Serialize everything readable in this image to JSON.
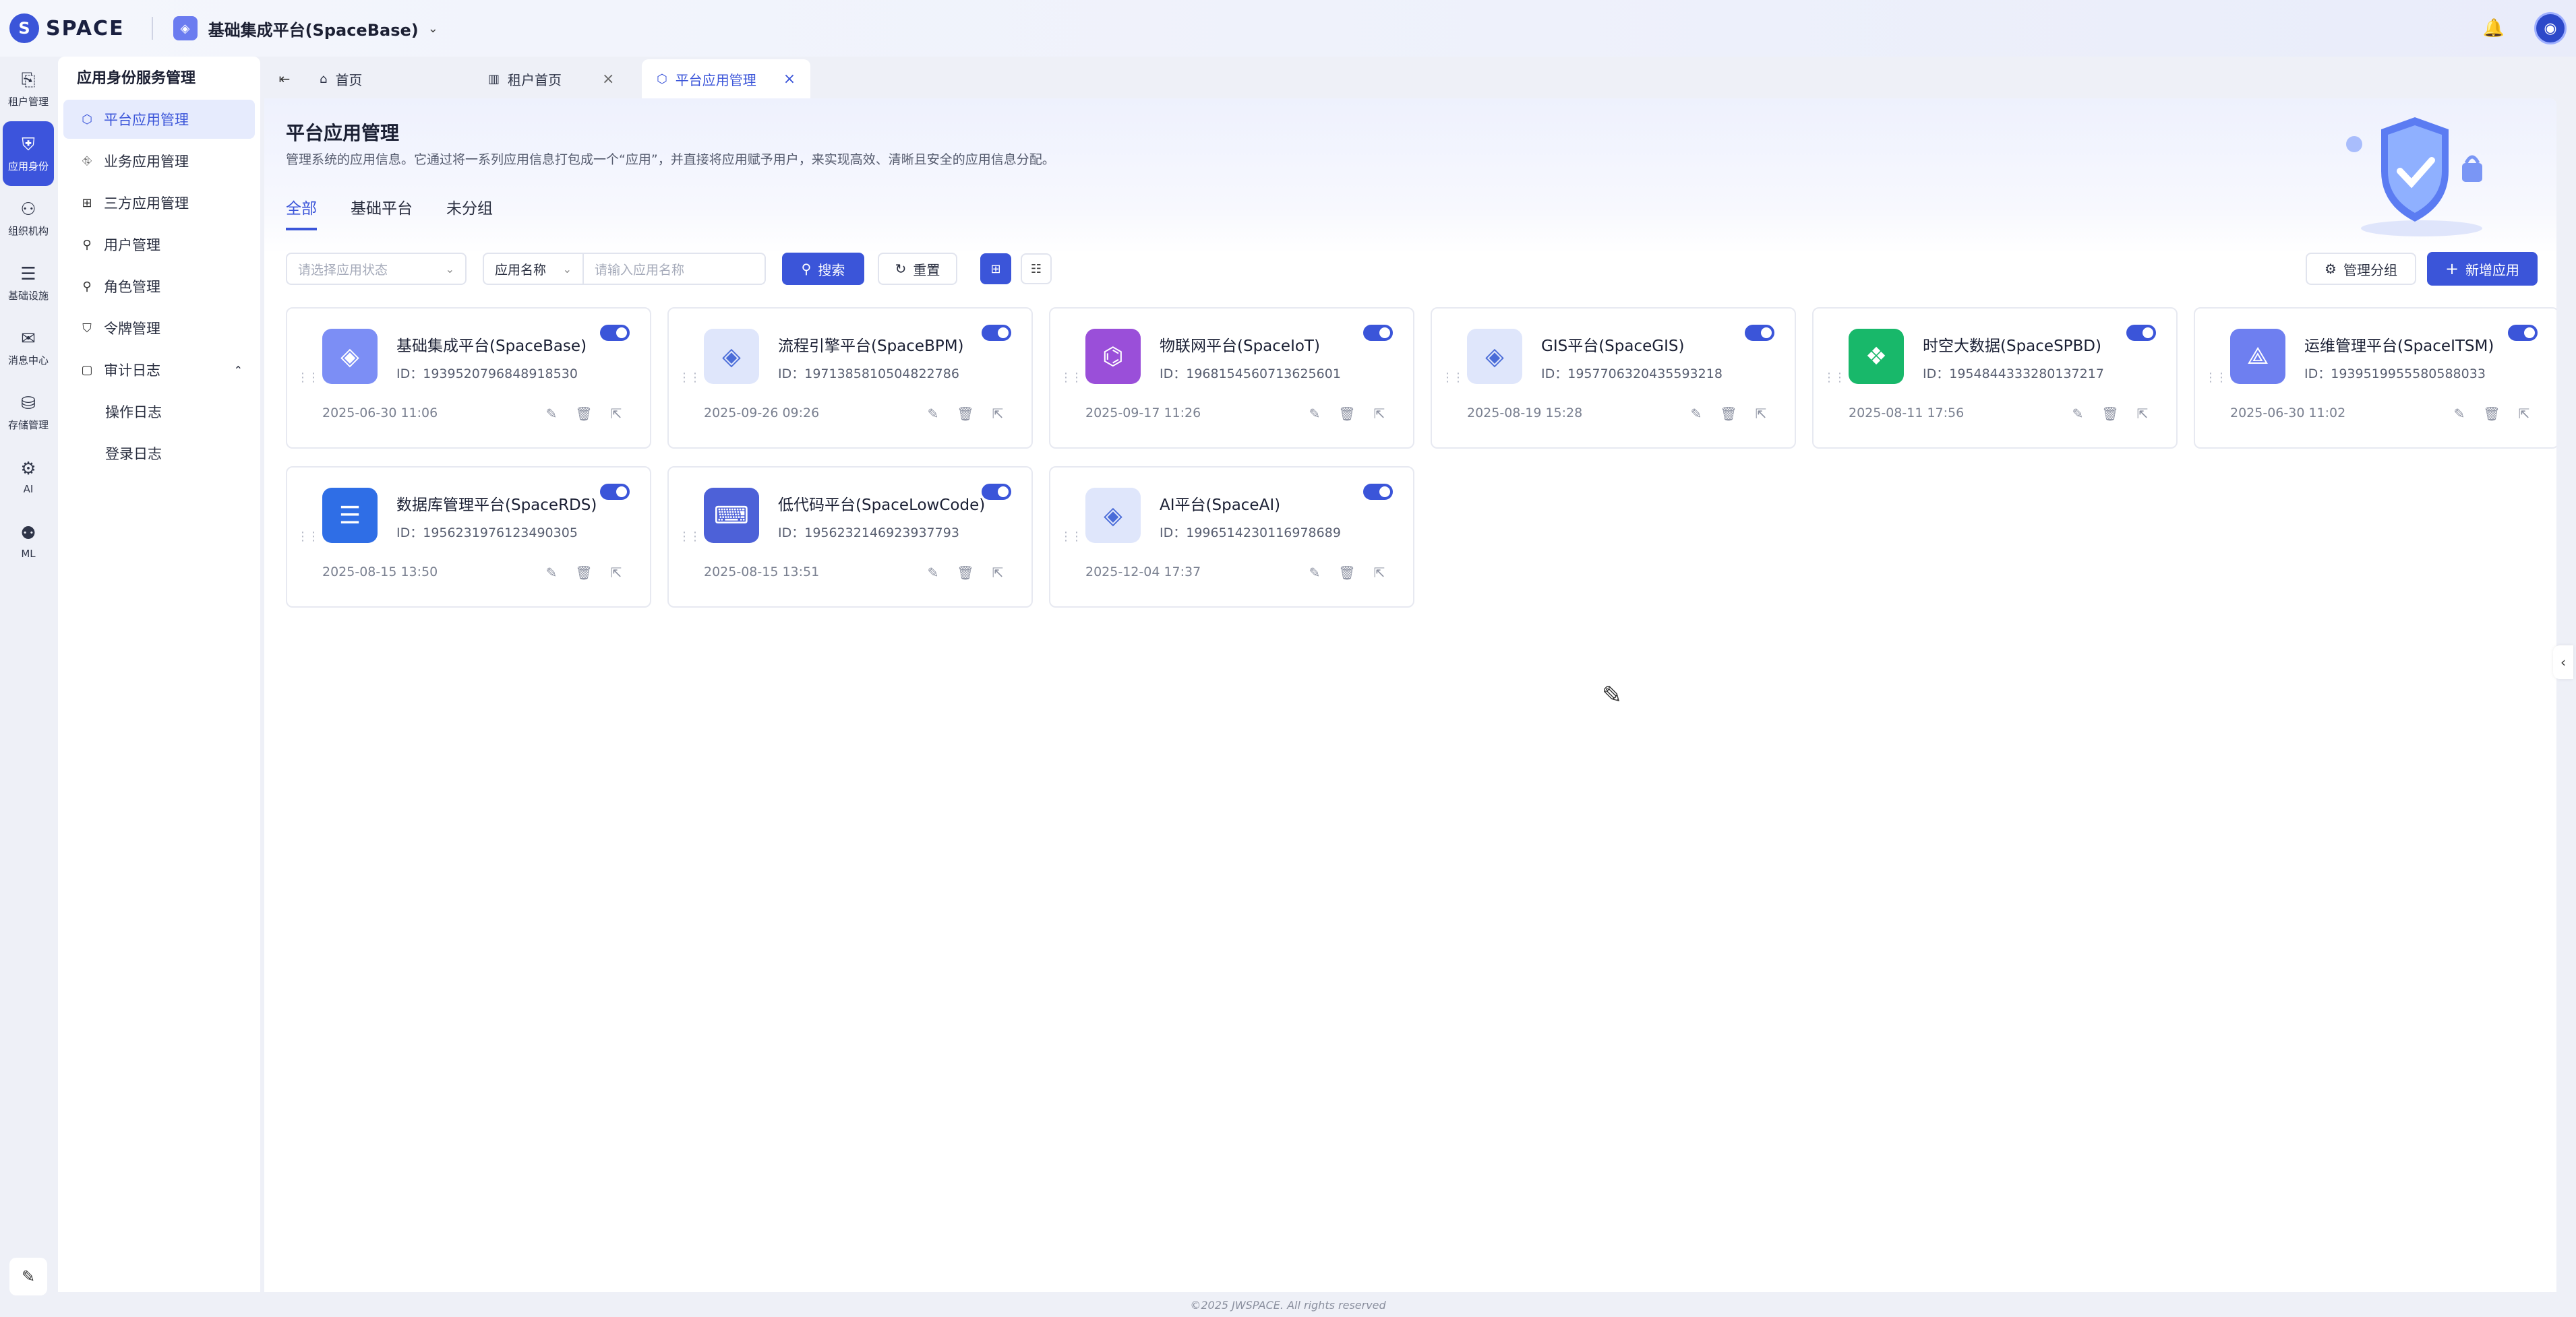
{
  "app": {
    "logo_mark": "S",
    "logo_text": "SPACE",
    "platform_name": "基础集成平台(SpaceBase)",
    "platform_chevron": "⌄",
    "bell": "🔔",
    "avatar": "◉"
  },
  "rail": [
    {
      "icon": "⎘",
      "label": "租户管理",
      "icon_name": "tenant-icon"
    },
    {
      "icon": "⛨",
      "label": "应用身份",
      "icon_name": "app-identity-icon"
    },
    {
      "icon": "⚇",
      "label": "组织机构",
      "icon_name": "org-icon"
    },
    {
      "icon": "☰",
      "label": "基础设施",
      "icon_name": "infra-icon"
    },
    {
      "icon": "✉",
      "label": "消息中心",
      "icon_name": "message-icon"
    },
    {
      "icon": "⛁",
      "label": "存储管理",
      "icon_name": "storage-icon"
    },
    {
      "icon": "⚙",
      "label": "AI",
      "icon_name": "ai-icon"
    },
    {
      "icon": "⚉",
      "label": "ML",
      "icon_name": "ml-icon"
    }
  ],
  "rail_bottom_icon": "✎",
  "menu": {
    "title": "应用身份服务管理",
    "items": [
      {
        "icon": "⬡",
        "label": "平台应用管理",
        "active": true
      },
      {
        "icon": "⛗",
        "label": "业务应用管理"
      },
      {
        "icon": "⊞",
        "label": "三方应用管理"
      },
      {
        "icon": "⚲",
        "label": "用户管理"
      },
      {
        "icon": "⚲",
        "label": "角色管理"
      },
      {
        "icon": "⛉",
        "label": "令牌管理"
      },
      {
        "icon": "▢",
        "label": "审计日志",
        "caret": "⌃"
      }
    ],
    "sub_items": [
      "操作日志",
      "登录日志"
    ]
  },
  "tabs": {
    "collapse_icon": "⇤",
    "home": {
      "icon": "⌂",
      "label": "首页"
    },
    "tenant": {
      "icon": "▥",
      "label": "租户首页",
      "close": "×"
    },
    "current": {
      "icon": "⬡",
      "label": "平台应用管理",
      "close": "×"
    }
  },
  "page": {
    "title": "平台应用管理",
    "description": "管理系统的应用信息。它通过将一系列应用信息打包成一个“应用”，并直接将应用赋予用户，来实现高效、清晰且安全的应用信息分配。"
  },
  "group_tabs": [
    "全部",
    "基础平台",
    "未分组"
  ],
  "filters": {
    "status_placeholder": "请选择应用状态",
    "field_select": "应用名称",
    "name_placeholder": "请输入应用名称",
    "search_icon": "⚲",
    "search_label": "搜索",
    "reset_icon": "↻",
    "reset_label": "重置",
    "grid_icon": "⊞",
    "list_icon": "☷",
    "group_icon": "⚙",
    "group_label": "管理分组",
    "add_icon": "+",
    "add_label": "新增应用",
    "select_arrow": "⌄"
  },
  "cards": [
    {
      "name": "基础集成平台(SpaceBase)",
      "id": "ID：1939520796848918530",
      "time": "2025-06-30 11:06",
      "color": "#7c8ef5",
      "glyph": "◈"
    },
    {
      "name": "流程引擎平台(SpaceBPM)",
      "id": "ID：1971385810504822786",
      "time": "2025-09-26 09:26",
      "color": "#dfe6fb",
      "glyph": "◈",
      "glyph_color": "#4a6cd8"
    },
    {
      "name": "物联网平台(SpaceIoT)",
      "id": "ID：1968154560713625601",
      "time": "2025-09-17 11:26",
      "color": "#9a4fd9",
      "glyph": "⌬"
    },
    {
      "name": "GIS平台(SpaceGIS)",
      "id": "ID：1957706320435593218",
      "time": "2025-08-19 15:28",
      "color": "#dfe6fb",
      "glyph": "◈",
      "glyph_color": "#4a6cd8"
    },
    {
      "name": "时空大数据(SpaceSPBD)",
      "id": "ID：1954844333280137217",
      "time": "2025-08-11 17:56",
      "color": "#18b86a",
      "glyph": "❖"
    },
    {
      "name": "运维管理平台(SpaceITSM)",
      "id": "ID：1939519955580588033",
      "time": "2025-06-30 11:02",
      "color": "#6e7ff0",
      "glyph": "⟁"
    },
    {
      "name": "数据库管理平台(SpaceRDS)",
      "id": "ID：1956231976123490305",
      "time": "2025-08-15 13:50",
      "color": "#2f6ee6",
      "glyph": "☰"
    },
    {
      "name": "低代码平台(SpaceLowCode)",
      "id": "ID：1956232146923937793",
      "time": "2025-08-15 13:51",
      "color": "#4d61d8",
      "glyph": "⌨"
    },
    {
      "name": "AI平台(SpaceAI)",
      "id": "ID：1996514230116978689",
      "time": "2025-12-04 17:37",
      "color": "#dfe6fb",
      "glyph": "◈",
      "glyph_color": "#4a6cd8"
    }
  ],
  "card_actions": {
    "edit": "✎",
    "delete": "🗑",
    "open": "⇱",
    "drag": "⋮⋮"
  },
  "side_handle": "‹",
  "cursor": "✎",
  "footer": "©2025 JWSPACE. All rights reserved"
}
